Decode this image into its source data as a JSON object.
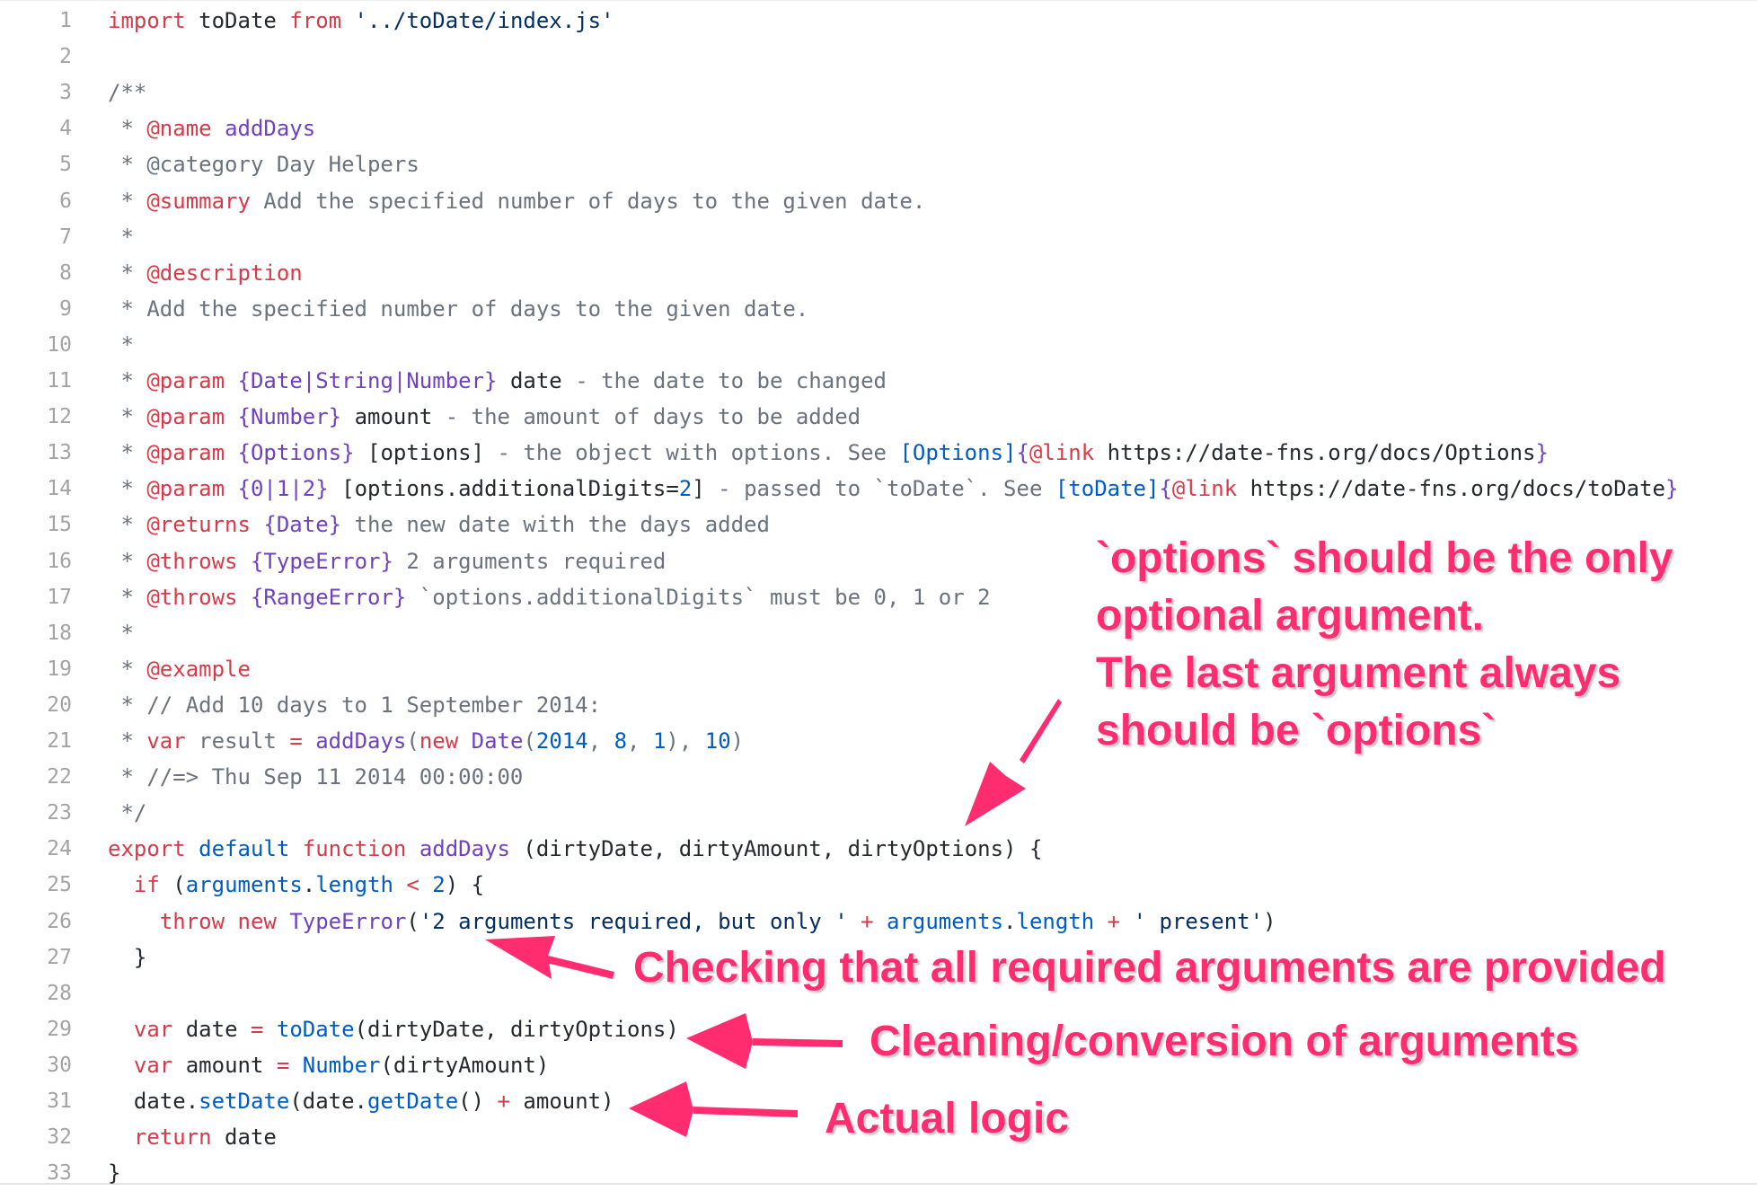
{
  "code_lines": [
    {
      "n": "1",
      "tokens": [
        [
          "import",
          "kw"
        ],
        [
          " toDate ",
          "tx"
        ],
        [
          "from",
          "kw"
        ],
        [
          " ",
          "tx"
        ],
        [
          "'../toDate/index.js'",
          "st"
        ]
      ]
    },
    {
      "n": "2",
      "tokens": []
    },
    {
      "n": "3",
      "tokens": [
        [
          "/**",
          "cm"
        ]
      ]
    },
    {
      "n": "4",
      "tokens": [
        [
          " * ",
          "cm"
        ],
        [
          "@name",
          "kw"
        ],
        [
          " ",
          "cm"
        ],
        [
          "addDays",
          "fn"
        ]
      ]
    },
    {
      "n": "5",
      "tokens": [
        [
          " * @category Day Helpers",
          "cm"
        ]
      ]
    },
    {
      "n": "6",
      "tokens": [
        [
          " * ",
          "cm"
        ],
        [
          "@summary",
          "kw"
        ],
        [
          " Add the specified number of days to the given date.",
          "cm"
        ]
      ]
    },
    {
      "n": "7",
      "tokens": [
        [
          " *",
          "cm"
        ]
      ]
    },
    {
      "n": "8",
      "tokens": [
        [
          " * ",
          "cm"
        ],
        [
          "@description",
          "kw"
        ]
      ]
    },
    {
      "n": "9",
      "tokens": [
        [
          " * Add the specified number of days to the given date.",
          "cm"
        ]
      ]
    },
    {
      "n": "10",
      "tokens": [
        [
          " *",
          "cm"
        ]
      ]
    },
    {
      "n": "11",
      "tokens": [
        [
          " * ",
          "cm"
        ],
        [
          "@param",
          "kw"
        ],
        [
          " ",
          "cm"
        ],
        [
          "{Date|String|Number}",
          "fn"
        ],
        [
          " ",
          "cm"
        ],
        [
          "date",
          "tx"
        ],
        [
          " - the date to be changed",
          "cm"
        ]
      ]
    },
    {
      "n": "12",
      "tokens": [
        [
          " * ",
          "cm"
        ],
        [
          "@param",
          "kw"
        ],
        [
          " ",
          "cm"
        ],
        [
          "{Number}",
          "fn"
        ],
        [
          " ",
          "cm"
        ],
        [
          "amount",
          "tx"
        ],
        [
          " - the amount of days to be added",
          "cm"
        ]
      ]
    },
    {
      "n": "13",
      "tokens": [
        [
          " * ",
          "cm"
        ],
        [
          "@param",
          "kw"
        ],
        [
          " ",
          "cm"
        ],
        [
          "{Options}",
          "fn"
        ],
        [
          " ",
          "cm"
        ],
        [
          "[options]",
          "tx"
        ],
        [
          " - the object with options. See ",
          "cm"
        ],
        [
          "[Options]",
          "cn"
        ],
        [
          "{",
          "fn"
        ],
        [
          "@link",
          "kw"
        ],
        [
          " ",
          "cm"
        ],
        [
          "https://date-fns.org/docs/Options",
          "tx"
        ],
        [
          "}",
          "fn"
        ]
      ]
    },
    {
      "n": "14",
      "tokens": [
        [
          " * ",
          "cm"
        ],
        [
          "@param",
          "kw"
        ],
        [
          " ",
          "cm"
        ],
        [
          "{0|1|2}",
          "fn"
        ],
        [
          " ",
          "cm"
        ],
        [
          "[options.additionalDigits=",
          "tx"
        ],
        [
          "2",
          "cn"
        ],
        [
          "]",
          "tx"
        ],
        [
          " - passed to `toDate`. See ",
          "cm"
        ],
        [
          "[toDate]",
          "cn"
        ],
        [
          "{",
          "fn"
        ],
        [
          "@link",
          "kw"
        ],
        [
          " ",
          "cm"
        ],
        [
          "https://date-fns.org/docs/toDate",
          "tx"
        ],
        [
          "}",
          "fn"
        ]
      ]
    },
    {
      "n": "15",
      "tokens": [
        [
          " * ",
          "cm"
        ],
        [
          "@returns",
          "kw"
        ],
        [
          " ",
          "cm"
        ],
        [
          "{Date}",
          "fn"
        ],
        [
          " the new date with the days added",
          "cm"
        ]
      ]
    },
    {
      "n": "16",
      "tokens": [
        [
          " * ",
          "cm"
        ],
        [
          "@throws",
          "kw"
        ],
        [
          " ",
          "cm"
        ],
        [
          "{TypeError}",
          "fn"
        ],
        [
          " 2 arguments required",
          "cm"
        ]
      ]
    },
    {
      "n": "17",
      "tokens": [
        [
          " * ",
          "cm"
        ],
        [
          "@throws",
          "kw"
        ],
        [
          " ",
          "cm"
        ],
        [
          "{RangeError}",
          "fn"
        ],
        [
          " `options.additionalDigits` must be 0, 1 or 2",
          "cm"
        ]
      ]
    },
    {
      "n": "18",
      "tokens": [
        [
          " *",
          "cm"
        ]
      ]
    },
    {
      "n": "19",
      "tokens": [
        [
          " * ",
          "cm"
        ],
        [
          "@example",
          "kw"
        ]
      ]
    },
    {
      "n": "20",
      "tokens": [
        [
          " * // Add 10 days to 1 September 2014:",
          "cm"
        ]
      ]
    },
    {
      "n": "21",
      "tokens": [
        [
          " * ",
          "cm"
        ],
        [
          "var",
          "kw"
        ],
        [
          " result ",
          "cm"
        ],
        [
          "=",
          "kw"
        ],
        [
          " ",
          "cm"
        ],
        [
          "addDays",
          "fn"
        ],
        [
          "(",
          "cm"
        ],
        [
          "new",
          "kw"
        ],
        [
          " ",
          "cm"
        ],
        [
          "Date",
          "fn"
        ],
        [
          "(",
          "cm"
        ],
        [
          "2014",
          "cn"
        ],
        [
          ", ",
          "cm"
        ],
        [
          "8",
          "cn"
        ],
        [
          ", ",
          "cm"
        ],
        [
          "1",
          "cn"
        ],
        [
          "), ",
          "cm"
        ],
        [
          "10",
          "cn"
        ],
        [
          ")",
          "cm"
        ]
      ]
    },
    {
      "n": "22",
      "tokens": [
        [
          " * //=> Thu Sep 11 2014 00:00:00",
          "cm"
        ]
      ]
    },
    {
      "n": "23",
      "tokens": [
        [
          " */",
          "cm"
        ]
      ]
    },
    {
      "n": "24",
      "tokens": [
        [
          "export",
          "kw"
        ],
        [
          " ",
          "tx"
        ],
        [
          "default",
          "cn"
        ],
        [
          " ",
          "tx"
        ],
        [
          "function",
          "kw"
        ],
        [
          " ",
          "tx"
        ],
        [
          "addDays",
          "fn"
        ],
        [
          " (dirtyDate, dirtyAmount, dirtyOptions) {",
          "tx"
        ]
      ]
    },
    {
      "n": "25",
      "tokens": [
        [
          "  ",
          "tx"
        ],
        [
          "if",
          "kw"
        ],
        [
          " (",
          "tx"
        ],
        [
          "arguments",
          "cn"
        ],
        [
          ".",
          "tx"
        ],
        [
          "length",
          "cn"
        ],
        [
          " ",
          "tx"
        ],
        [
          "<",
          "kw"
        ],
        [
          " ",
          "tx"
        ],
        [
          "2",
          "cn"
        ],
        [
          ") {",
          "tx"
        ]
      ]
    },
    {
      "n": "26",
      "tokens": [
        [
          "    ",
          "tx"
        ],
        [
          "throw",
          "kw"
        ],
        [
          " ",
          "tx"
        ],
        [
          "new",
          "kw"
        ],
        [
          " ",
          "tx"
        ],
        [
          "TypeError",
          "fn"
        ],
        [
          "(",
          "tx"
        ],
        [
          "'2 arguments required, but only '",
          "st"
        ],
        [
          " ",
          "tx"
        ],
        [
          "+",
          "kw"
        ],
        [
          " ",
          "tx"
        ],
        [
          "arguments",
          "cn"
        ],
        [
          ".",
          "tx"
        ],
        [
          "length",
          "cn"
        ],
        [
          " ",
          "tx"
        ],
        [
          "+",
          "kw"
        ],
        [
          " ",
          "tx"
        ],
        [
          "' present'",
          "st"
        ],
        [
          ")",
          "tx"
        ]
      ]
    },
    {
      "n": "27",
      "tokens": [
        [
          "  }",
          "tx"
        ]
      ]
    },
    {
      "n": "28",
      "tokens": []
    },
    {
      "n": "29",
      "tokens": [
        [
          "  ",
          "tx"
        ],
        [
          "var",
          "kw"
        ],
        [
          " date ",
          "tx"
        ],
        [
          "=",
          "kw"
        ],
        [
          " ",
          "tx"
        ],
        [
          "toDate",
          "cn"
        ],
        [
          "(dirtyDate, dirtyOptions)",
          "tx"
        ]
      ]
    },
    {
      "n": "30",
      "tokens": [
        [
          "  ",
          "tx"
        ],
        [
          "var",
          "kw"
        ],
        [
          " amount ",
          "tx"
        ],
        [
          "=",
          "kw"
        ],
        [
          " ",
          "tx"
        ],
        [
          "Number",
          "cn"
        ],
        [
          "(dirtyAmount)",
          "tx"
        ]
      ]
    },
    {
      "n": "31",
      "tokens": [
        [
          "  date.",
          "tx"
        ],
        [
          "setDate",
          "cn"
        ],
        [
          "(date.",
          "tx"
        ],
        [
          "getDate",
          "cn"
        ],
        [
          "() ",
          "tx"
        ],
        [
          "+",
          "kw"
        ],
        [
          " amount)",
          "tx"
        ]
      ]
    },
    {
      "n": "32",
      "tokens": [
        [
          "  ",
          "tx"
        ],
        [
          "return",
          "kw"
        ],
        [
          " date",
          "tx"
        ]
      ]
    },
    {
      "n": "33",
      "tokens": [
        [
          "}",
          "tx"
        ]
      ]
    }
  ],
  "annotations": {
    "options_note": "`options` should be the only\noptional argument.\nThe last argument always\nshould be `options`",
    "checking_note": "Checking that all required arguments are provided",
    "cleaning_note": "Cleaning/conversion of arguments",
    "logic_note": "Actual logic"
  },
  "colors": {
    "keyword": "#d73a49",
    "entity": "#6f42c1",
    "constant": "#005cc5",
    "string": "#032f62",
    "comment": "#6a737d",
    "annotation": "#ff2d6f"
  }
}
